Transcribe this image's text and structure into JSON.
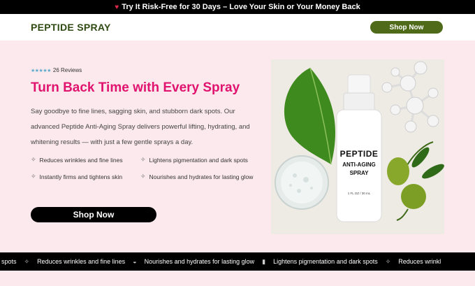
{
  "promo": {
    "icon": "heart-icon",
    "text": "Try It Risk-Free for 30 Days – Love Your Skin or Your Money Back"
  },
  "header": {
    "brand": "PEPTIDE SPRAY",
    "cta_label": "Shop Now"
  },
  "hero": {
    "rating": {
      "stars": "★★★★★",
      "reviews_text": "26 Reviews"
    },
    "title": "Turn Back Time with Every Spray",
    "description": "Say goodbye to fine lines, sagging skin, and stubborn dark spots. Our advanced Peptide Anti-Aging Spray delivers powerful lifting, hydrating, and whitening results — with just a few gentle sprays a day.",
    "features": [
      "Reduces wrinkles and fine lines",
      "Lightens pigmentation and dark spots",
      "Instantly firms and tightens skin",
      "Nourishes and hydrates for lasting glow"
    ],
    "cta_label": "Shop Now",
    "product": {
      "line1": "PEPTIDE",
      "line2": "ANTI-AGING",
      "line3": "SPRAY",
      "volume": "1 FL OZ / 30 mL"
    }
  },
  "ticker": {
    "items": [
      "spots",
      "Reduces wrinkles and fine lines",
      "Nourishes and hydrates for lasting glow",
      "Lightens pigmentation and dark spots",
      "Reduces wrinkl"
    ]
  },
  "colors": {
    "accent_pink": "#e0146e",
    "brand_green": "#2f4a12",
    "button_green": "#4f6b1a",
    "hero_bg": "#fce9ee"
  }
}
